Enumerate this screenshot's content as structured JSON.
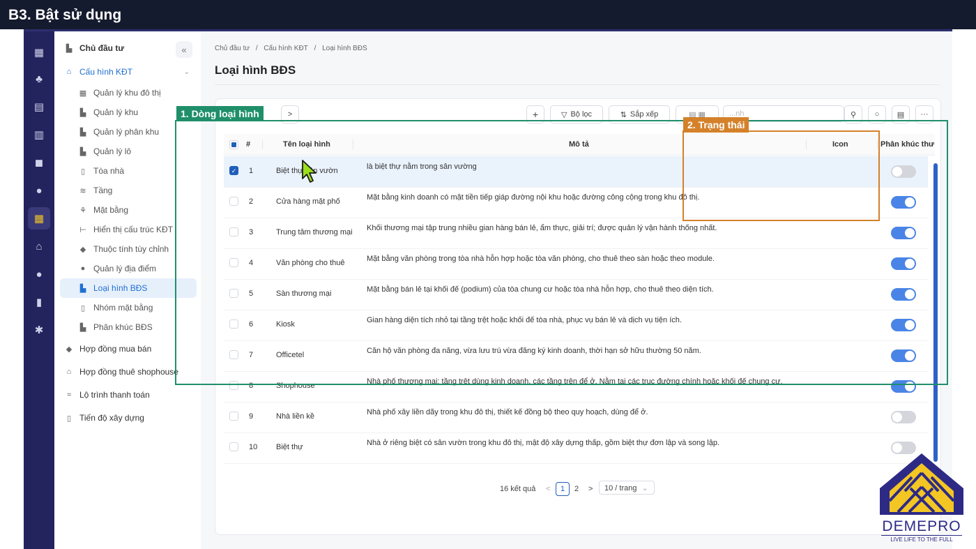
{
  "step_title": "B3. Bật sử dụng",
  "sidebar": {
    "items": [
      {
        "label": "Chủ đầu tư",
        "icon": "building-icon",
        "level": 0
      },
      {
        "label": "Cấu hình KĐT",
        "icon": "bank-icon",
        "level": 1
      },
      {
        "label": "Quản lý khu đô thị",
        "icon": "city-icon",
        "level": 2
      },
      {
        "label": "Quản lý khu",
        "icon": "building-icon",
        "level": 2
      },
      {
        "label": "Quản lý phân khu",
        "icon": "building-icon",
        "level": 2
      },
      {
        "label": "Quản lý lô",
        "icon": "building-icon",
        "level": 2
      },
      {
        "label": "Tòa nhà",
        "icon": "tower-icon",
        "level": 2
      },
      {
        "label": "Tầng",
        "icon": "layers-icon",
        "level": 2
      },
      {
        "label": "Mặt bằng",
        "icon": "floorplan-icon",
        "level": 2
      },
      {
        "label": "Hiển thị cấu trúc KĐT",
        "icon": "tree-icon",
        "level": 2
      },
      {
        "label": "Thuộc tính tùy chỉnh",
        "icon": "tag-icon",
        "level": 2
      },
      {
        "label": "Quản lý địa điểm",
        "icon": "pin-icon",
        "level": 2
      },
      {
        "label": "Loại hình BĐS",
        "icon": "building-icon",
        "level": 2
      },
      {
        "label": "Nhóm mặt bằng",
        "icon": "tower-icon",
        "level": 2
      },
      {
        "label": "Phân khúc BĐS",
        "icon": "building-icon",
        "level": 2
      },
      {
        "label": "Hợp đồng mua bán",
        "icon": "tag-icon",
        "level": 1
      },
      {
        "label": "Hợp đồng thuê shophouse",
        "icon": "store-icon",
        "level": 1
      },
      {
        "label": "Lộ trình thanh toán",
        "icon": "money-icon",
        "level": 1
      },
      {
        "label": "Tiến độ xây dựng",
        "icon": "tower-icon",
        "level": 1
      }
    ]
  },
  "breadcrumb": [
    "Chủ đầu tư",
    "/",
    "Cấu hình KĐT",
    "/",
    "Loại hình BĐS"
  ],
  "page_title": "Loại hình BĐS",
  "toolbar": {
    "nav_next": ">",
    "add": "+",
    "filter": "Bộ lọc",
    "sort": "Sắp xếp",
    "search_placeholder": "...nh",
    "more": "···"
  },
  "table": {
    "headers": {
      "index": "#",
      "name": "Tên loại hình",
      "description": "Mô tả",
      "icon": "Icon",
      "segment": "Phân khúc thư"
    },
    "rows": [
      {
        "index": "1",
        "name": "Biệt thự sân vườn",
        "description": "là biệt thự nằm trong sân vường",
        "checked": true,
        "enabled": false
      },
      {
        "index": "2",
        "name": "Cửa hàng mặt phố",
        "description": "Mặt bằng kinh doanh có mặt tiền tiếp giáp đường nội khu hoặc đường công cộng trong khu đô thị.",
        "checked": false,
        "enabled": true
      },
      {
        "index": "3",
        "name": "Trung tâm thương mại",
        "description": "Khối thương mại tập trung nhiều gian hàng bán lẻ, ẩm thực, giải trí; được quản lý vận hành thống nhất.",
        "checked": false,
        "enabled": true
      },
      {
        "index": "4",
        "name": "Văn phòng cho thuê",
        "description": "Mặt bằng văn phòng trong tòa nhà hỗn hợp hoặc tòa văn phòng, cho thuê theo sàn hoặc theo module.",
        "checked": false,
        "enabled": true
      },
      {
        "index": "5",
        "name": "Sàn thương mại",
        "description": "Mặt bằng bán lẻ tại khối đế (podium) của tòa chung cư hoặc tòa nhà hỗn hợp, cho thuê theo diện tích.",
        "checked": false,
        "enabled": true
      },
      {
        "index": "6",
        "name": "Kiosk",
        "description": "Gian hàng diện tích nhỏ tại tầng trệt hoặc khối đế tòa nhà, phục vụ bán lẻ và dịch vụ tiện ích.",
        "checked": false,
        "enabled": true
      },
      {
        "index": "7",
        "name": "Officetel",
        "description": "Căn hộ văn phòng đa năng, vừa lưu trú vừa đăng ký kinh doanh, thời hạn sở hữu thường 50 năm.",
        "checked": false,
        "enabled": true
      },
      {
        "index": "8",
        "name": "Shophouse",
        "description": "Nhà phố thương mại: tầng trệt dùng kinh doanh, các tầng trên để ở. Nằm tại các trục đường chính hoặc khối đế chung cư.",
        "checked": false,
        "enabled": true
      },
      {
        "index": "9",
        "name": "Nhà liền kề",
        "description": "Nhà phố xây liền dãy trong khu đô thị, thiết kế đồng bộ theo quy hoạch, dùng để ở.",
        "checked": false,
        "enabled": false
      },
      {
        "index": "10",
        "name": "Biệt thự",
        "description": "Nhà ở riêng biệt có sân vườn trong khu đô thị, mật độ xây dựng thấp, gồm biệt thự đơn lập và song lập.",
        "checked": false,
        "enabled": false
      }
    ]
  },
  "pagination": {
    "total": "16 kết quả",
    "prev": "<",
    "page1": "1",
    "page2": "2",
    "next": ">",
    "page_size": "10 / trang"
  },
  "annotations": {
    "row_label": "1. Dòng loại hình",
    "status_label": "2. Trạng thái",
    "row_color": "#1f8f6a",
    "status_color": "#d4812a"
  },
  "logo": {
    "name": "DEMEPRO",
    "tagline": "LIVE LIFE TO THE FULL",
    "color": "#2d2a86",
    "accent": "#f3c623"
  },
  "colors": {
    "primary": "#1f5fb8",
    "toggle_on": "#4a84e6",
    "rail": "#23235e",
    "topbar": "#151b2e"
  }
}
